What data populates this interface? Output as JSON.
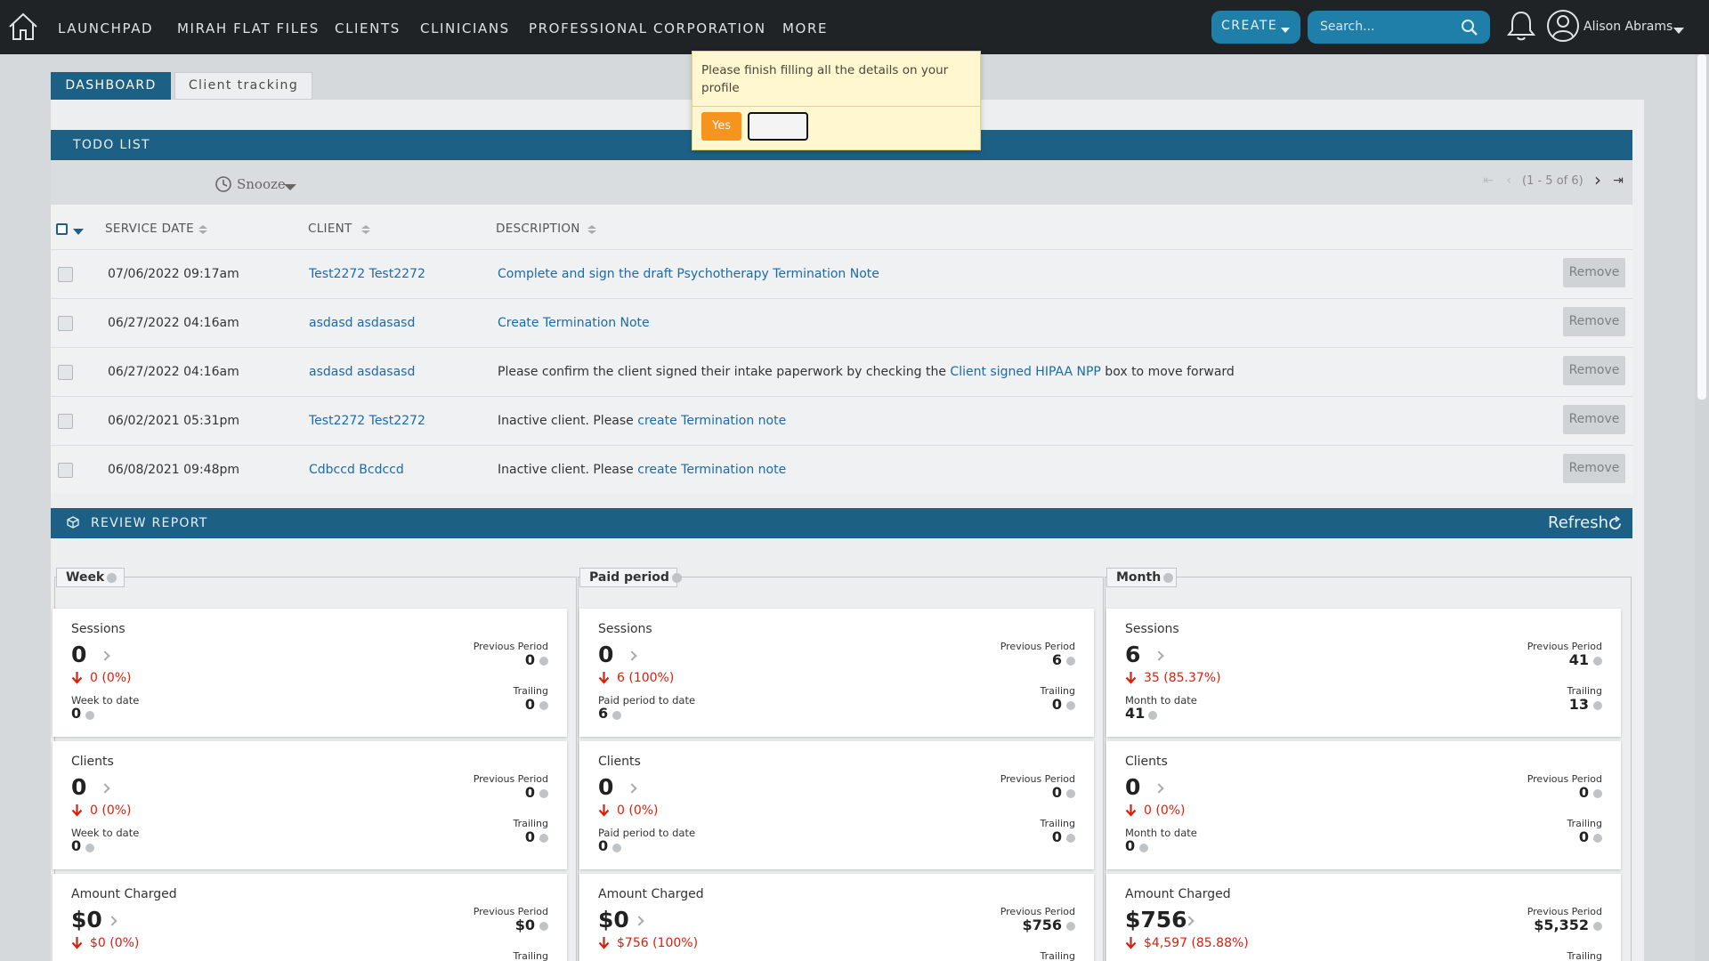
{
  "nav": {
    "items": [
      "LAUNCHPAD",
      "MIRAH FLAT FILES",
      "CLIENTS",
      "CLINICIANS",
      "PROFESSIONAL CORPORATION",
      "MORE"
    ],
    "create_label": "CREATE",
    "search_placeholder": "Search...",
    "user_name": "Alison Abrams"
  },
  "tabs": [
    "DASHBOARD",
    "Client tracking"
  ],
  "popover": {
    "message": "Please finish filling all the details on your profile",
    "yes_label": "Yes",
    "no_label": ""
  },
  "todo": {
    "title": "TODO LIST",
    "snooze_label": "Snooze",
    "pager_text": "(1 - 5 of 6)",
    "columns": [
      "SERVICE DATE",
      "CLIENT",
      "DESCRIPTION"
    ],
    "remove_label": "Remove",
    "rows": [
      {
        "date": "07/06/2022 09:17am",
        "client": "Test2272 Test2272",
        "desc_pre": "",
        "desc_link": "Complete and sign the draft Psychotherapy Termination Note",
        "desc_post": ""
      },
      {
        "date": "06/27/2022 04:16am",
        "client": "asdasd asdasasd",
        "desc_pre": "",
        "desc_link": "Create Termination Note",
        "desc_post": ""
      },
      {
        "date": "06/27/2022 04:16am",
        "client": "asdasd asdasasd",
        "desc_pre": "Please confirm the client signed their intake paperwork by checking the ",
        "desc_link": "Client signed HIPAA NPP",
        "desc_post": " box to move forward"
      },
      {
        "date": "06/02/2021 05:31pm",
        "client": "Test2272 Test2272",
        "desc_pre": "Inactive client. Please ",
        "desc_link": "create Termination note",
        "desc_post": ""
      },
      {
        "date": "06/08/2021 09:48pm",
        "client": "Cdbccd Bcdccd",
        "desc_pre": "Inactive client. Please ",
        "desc_link": "create Termination note",
        "desc_post": ""
      }
    ]
  },
  "review": {
    "title": "REVIEW REPORT",
    "refresh_label": "Refresh",
    "previous_label": "Previous Period",
    "trailing_label": "Trailing",
    "columns": [
      {
        "name": "Week",
        "todate_label": "Week to date",
        "cards": [
          {
            "title": "Sessions",
            "value": "0",
            "delta": "0 (0%)",
            "todate": "0",
            "previous": "0",
            "trailing": "0"
          },
          {
            "title": "Clients",
            "value": "0",
            "delta": "0 (0%)",
            "todate": "0",
            "previous": "0",
            "trailing": "0"
          },
          {
            "title": "Amount Charged",
            "value": "$0",
            "delta": "$0 (0%)",
            "todate": "",
            "previous": "$0",
            "trailing": ""
          }
        ]
      },
      {
        "name": "Paid period",
        "todate_label": "Paid period to date",
        "cards": [
          {
            "title": "Sessions",
            "value": "0",
            "delta": "6 (100%)",
            "todate": "6",
            "previous": "6",
            "trailing": "0"
          },
          {
            "title": "Clients",
            "value": "0",
            "delta": "0 (0%)",
            "todate": "0",
            "previous": "0",
            "trailing": "0"
          },
          {
            "title": "Amount Charged",
            "value": "$0",
            "delta": "$756 (100%)",
            "todate": "",
            "previous": "$756",
            "trailing": ""
          }
        ]
      },
      {
        "name": "Month",
        "todate_label": "Month to date",
        "cards": [
          {
            "title": "Sessions",
            "value": "6",
            "delta": "35 (85.37%)",
            "todate": "41",
            "previous": "41",
            "trailing": "13"
          },
          {
            "title": "Clients",
            "value": "0",
            "delta": "0 (0%)",
            "todate": "0",
            "previous": "0",
            "trailing": "0"
          },
          {
            "title": "Amount Charged",
            "value": "$756",
            "delta": "$4,597 (85.88%)",
            "todate": "",
            "previous": "$5,352",
            "trailing": ""
          }
        ]
      }
    ]
  },
  "colors": {
    "nav_bg": "#1f2326",
    "accent_blue": "#1d6086",
    "create_blue": "#1f7fa8",
    "link_blue": "#1d6aa6",
    "negative_red": "#d9200e",
    "popover_yes": "#f7941d"
  },
  "icons": [
    "home-icon",
    "search-icon",
    "bell-icon",
    "user-avatar-icon",
    "clock-icon",
    "sort-icon",
    "refresh-icon",
    "arrow-down-icon",
    "help-icon",
    "chevron-right-icon",
    "first-page-icon",
    "prev-page-icon",
    "next-page-icon",
    "last-page-icon"
  ]
}
